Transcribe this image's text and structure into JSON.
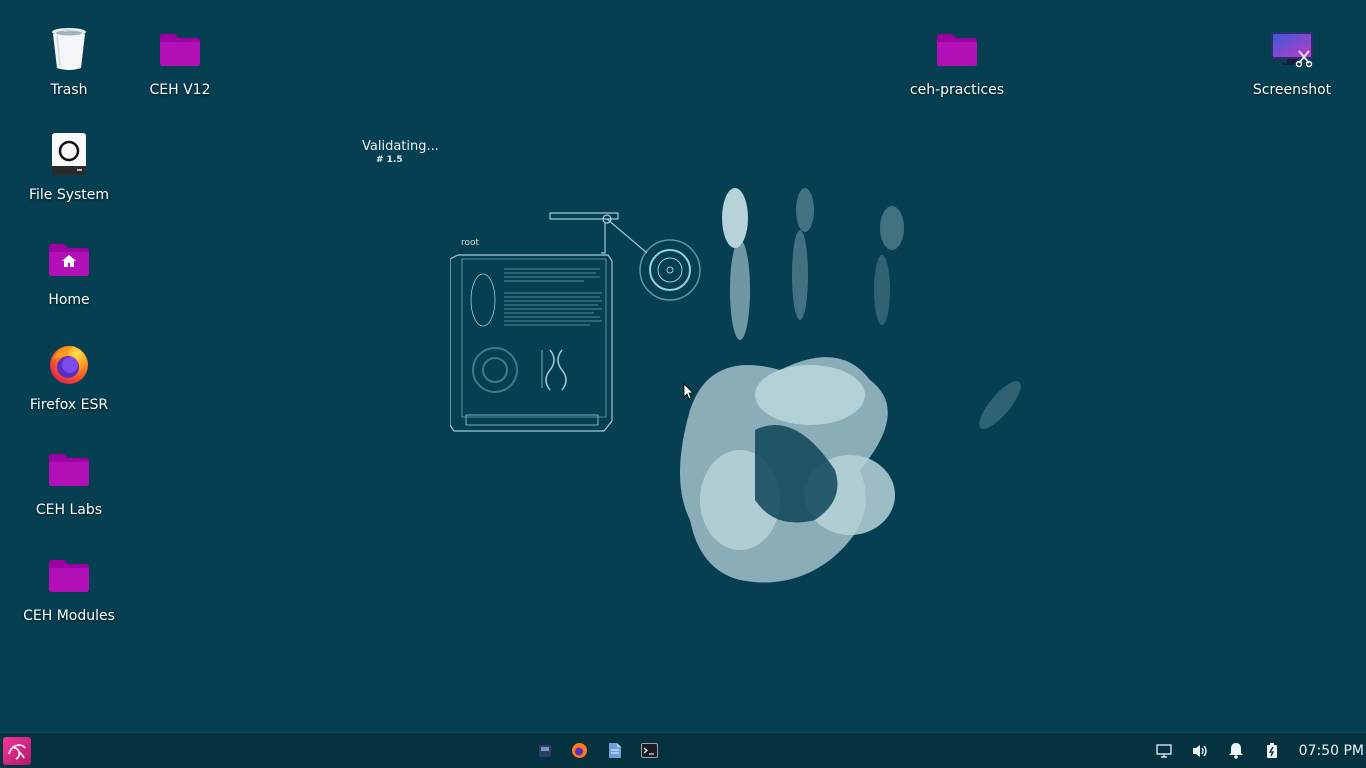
{
  "desktop": {
    "icons": [
      {
        "id": "trash",
        "label": "Trash",
        "icon": "trash-icon"
      },
      {
        "id": "ceh-v12",
        "label": "CEH V12",
        "icon": "folder-icon"
      },
      {
        "id": "ceh-practices",
        "label": "ceh-practices",
        "icon": "folder-icon"
      },
      {
        "id": "screenshot",
        "label": "Screenshot",
        "icon": "screenshot-icon"
      },
      {
        "id": "file-system",
        "label": "File System",
        "icon": "drive-icon"
      },
      {
        "id": "home",
        "label": "Home",
        "icon": "home-folder-icon"
      },
      {
        "id": "firefox",
        "label": "Firefox ESR",
        "icon": "firefox-icon"
      },
      {
        "id": "ceh-labs",
        "label": "CEH Labs",
        "icon": "folder-icon"
      },
      {
        "id": "ceh-modules",
        "label": "CEH Modules",
        "icon": "folder-icon"
      }
    ],
    "folder_color": "#b000b5"
  },
  "wallpaper": {
    "status_text": "Validating...",
    "status_sub": "# 1.5",
    "panel_label": "root"
  },
  "taskbar": {
    "start_icon": "kali-dragon-icon",
    "launchers": [
      "workspace-icon",
      "firefox-icon",
      "files-icon",
      "terminal-icon"
    ],
    "tray": [
      "display-icon",
      "volume-icon",
      "notification-bell-icon",
      "battery-icon"
    ],
    "clock": "07:50 PM",
    "accent": "#e0237f"
  }
}
